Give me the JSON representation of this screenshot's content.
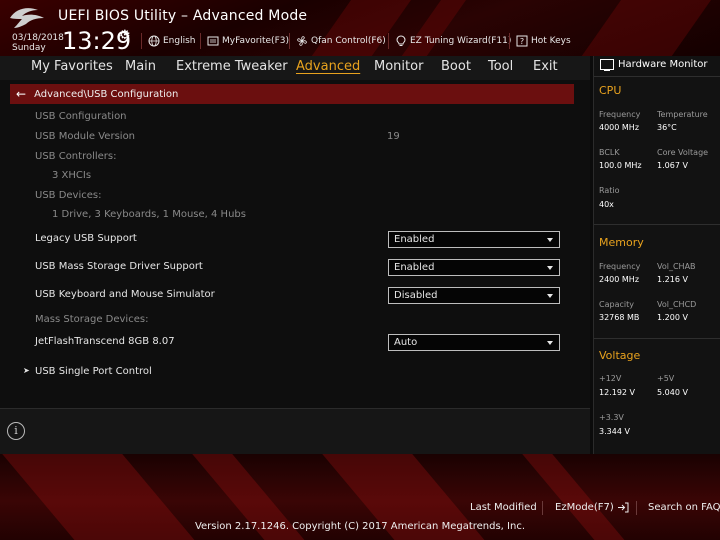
{
  "header": {
    "title": "UEFI BIOS Utility – Advanced Mode",
    "date": "03/18/2018",
    "day": "Sunday",
    "time": "13:29",
    "buttons": [
      {
        "label": "English",
        "icon": "globe-icon"
      },
      {
        "label": "MyFavorite(F3)",
        "icon": "favorite-icon"
      },
      {
        "label": "Qfan Control(F6)",
        "icon": "fan-icon"
      },
      {
        "label": "EZ Tuning Wizard(F11)",
        "icon": "bulb-icon"
      },
      {
        "label": "Hot Keys",
        "icon": "question-icon"
      }
    ]
  },
  "menu": {
    "items": [
      "My Favorites",
      "Main",
      "Extreme Tweaker",
      "Advanced",
      "Monitor",
      "Boot",
      "Tool",
      "Exit"
    ],
    "active": "Advanced"
  },
  "breadcrumb": "Advanced\\USB Configuration",
  "usb": {
    "section_title": "USB Configuration",
    "module_version_label": "USB Module Version",
    "module_version_value": "19",
    "controllers_label": "USB Controllers:",
    "controllers_value": "3 XHCIs",
    "devices_label": "USB Devices:",
    "devices_value": "1 Drive, 3 Keyboards, 1 Mouse, 4 Hubs",
    "legacy_label": "Legacy USB Support",
    "legacy_value": "Enabled",
    "mass_storage_driver_label": "USB Mass Storage Driver Support",
    "mass_storage_driver_value": "Enabled",
    "kbd_mouse_sim_label": "USB Keyboard and Mouse Simulator",
    "kbd_mouse_sim_value": "Disabled",
    "mass_storage_devices_label": "Mass Storage Devices:",
    "jetflash_label": "JetFlashTranscend 8GB 8.07",
    "jetflash_value": "Auto",
    "single_port_label": "USB Single Port Control"
  },
  "hw_monitor": {
    "title": "Hardware Monitor",
    "cpu": {
      "title": "CPU",
      "frequency_label": "Frequency",
      "frequency_value": "4000 MHz",
      "temperature_label": "Temperature",
      "temperature_value": "36°C",
      "bclk_label": "BCLK",
      "bclk_value": "100.0 MHz",
      "core_voltage_label": "Core Voltage",
      "core_voltage_value": "1.067 V",
      "ratio_label": "Ratio",
      "ratio_value": "40x"
    },
    "memory": {
      "title": "Memory",
      "frequency_label": "Frequency",
      "frequency_value": "2400 MHz",
      "vol_chab_label": "Vol_CHAB",
      "vol_chab_value": "1.216 V",
      "capacity_label": "Capacity",
      "capacity_value": "32768 MB",
      "vol_chcd_label": "Vol_CHCD",
      "vol_chcd_value": "1.200 V"
    },
    "voltage": {
      "title": "Voltage",
      "v12_label": "+12V",
      "v12_value": "12.192 V",
      "v5_label": "+5V",
      "v5_value": "5.040 V",
      "v33_label": "+3.3V",
      "v33_value": "3.344 V"
    }
  },
  "footer": {
    "last_modified": "Last Modified",
    "ezmode": "EzMode(F7)",
    "search": "Search on FAQ",
    "copyright": "Version 2.17.1246. Copyright (C) 2017 American Megatrends, Inc."
  },
  "colors": {
    "accent": "#e8a21e",
    "brand_red": "#6b0f0f",
    "background": "#0b0b0b"
  }
}
